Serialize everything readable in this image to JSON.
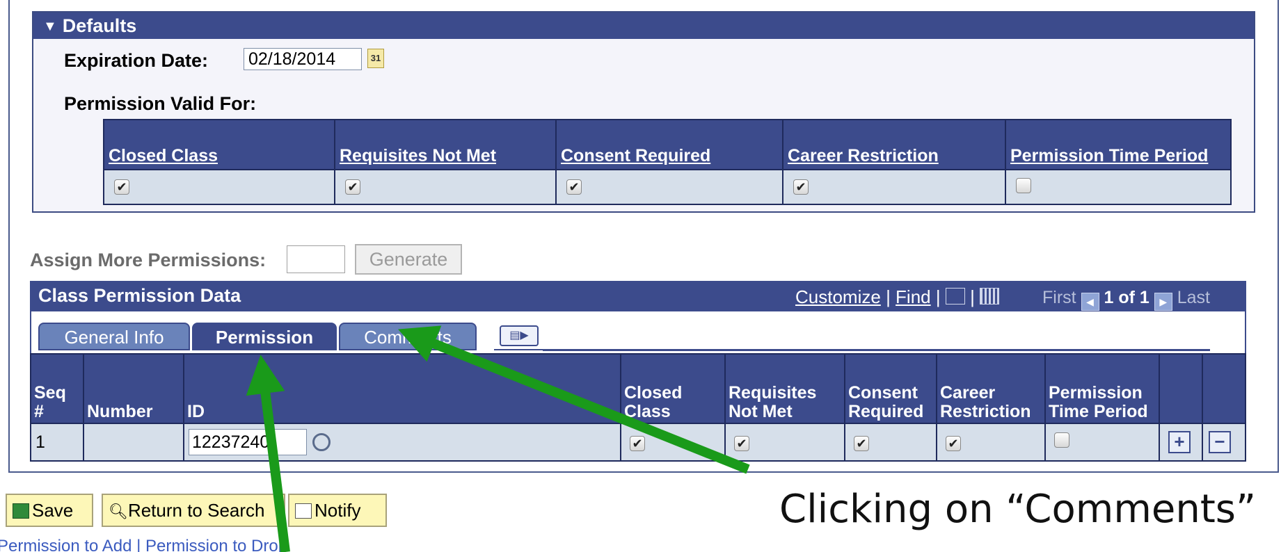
{
  "defaults": {
    "title": "Defaults",
    "expiration_label": "Expiration Date:",
    "expiration_value": "02/18/2014",
    "calendar_glyph": "31",
    "valid_for_label": "Permission Valid For:",
    "columns": [
      "Closed Class",
      "Requisites Not Met",
      "Consent Required",
      "Career Restriction",
      "Permission Time Period"
    ],
    "checked": [
      true,
      true,
      true,
      true,
      false
    ]
  },
  "assign": {
    "label": "Assign More Permissions:",
    "generate_label": "Generate"
  },
  "class_permission": {
    "title": "Class Permission Data",
    "customize": "Customize",
    "find": "Find",
    "first": "First",
    "page": "1 of 1",
    "last": "Last",
    "tabs": [
      "General Info",
      "Permission",
      "Comments"
    ],
    "active_tab": "Permission",
    "headers": {
      "seq": "Seq #",
      "number": "Number",
      "id": "ID",
      "closed": "Closed Class",
      "requisites": "Requisites Not Met",
      "consent": "Consent Required",
      "career": "Career Restriction",
      "time": "Permission Time Period"
    },
    "row": {
      "seq": "1",
      "number": "",
      "id": "12237240",
      "checks": [
        true,
        true,
        true,
        true,
        false
      ]
    }
  },
  "toolbar": {
    "save": "Save",
    "return_to_search": "Return to Search",
    "notify": "Notify",
    "links": "Permission to Add | Permission to Drop"
  },
  "annotation": {
    "caption": "Clicking on “Comments”",
    "arrow_color": "#1a9a1a"
  },
  "colors": {
    "header_blue": "#3c4b8c",
    "row_blue": "#d6dfea",
    "toolbar_yellow": "#fdf7b8"
  }
}
